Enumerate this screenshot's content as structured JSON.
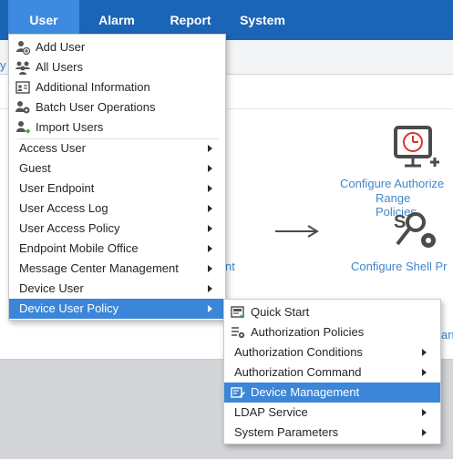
{
  "topnav": {
    "tabs": [
      "User",
      "Alarm",
      "Report",
      "System"
    ]
  },
  "background": {
    "crumb_fragment": "y",
    "link_authorization_line1": "Configure Authorize",
    "link_authorization_line2": "Range Policies",
    "link_shell": "Configure Shell Pr",
    "link_left_fragment": "nt",
    "link_right_fragment": "an"
  },
  "user_menu": {
    "quick_items": [
      "Add User",
      "All Users",
      "Additional Information",
      "Batch User Operations",
      "Import Users"
    ],
    "submenus": [
      "Access User",
      "Guest",
      "User Endpoint",
      "User Access Log",
      "User Access Policy",
      "Endpoint Mobile Office",
      "Message Center Management",
      "Device User",
      "Device User Policy"
    ],
    "highlighted": "Device User Policy"
  },
  "device_policy_menu": {
    "items": [
      "Quick Start",
      "Authorization Policies",
      "Authorization Conditions",
      "Authorization Command",
      "Device Management",
      "LDAP Service",
      "System Parameters"
    ],
    "highlighted": "Device Management"
  },
  "colors": {
    "nav_bg": "#1b65b6",
    "nav_active": "#3d8be0",
    "menu_highlight": "#3b86d8",
    "link": "#3f88c9",
    "accent_icon": "#d9342b"
  }
}
